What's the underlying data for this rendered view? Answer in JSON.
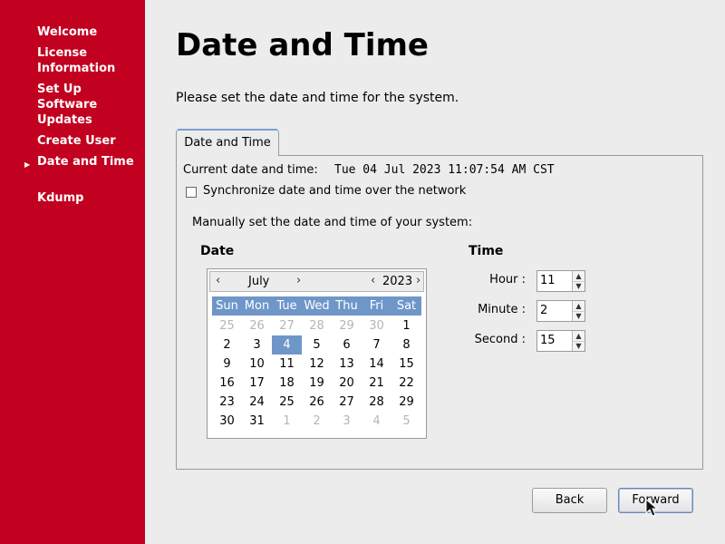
{
  "sidebar": {
    "items": [
      {
        "label": "Welcome"
      },
      {
        "label": "License Information"
      },
      {
        "label": "Set Up Software Updates"
      },
      {
        "label": "Create User"
      },
      {
        "label": "Date and Time"
      },
      {
        "label": "Kdump"
      }
    ],
    "active_icon": "arrow-right-icon"
  },
  "page": {
    "title": "Date and Time",
    "instruction": "Please set the date and time for the system."
  },
  "tab": {
    "label": "Date and Time"
  },
  "current": {
    "label": "Current date and time:",
    "value": "Tue 04 Jul 2023 11:07:54 AM CST"
  },
  "sync": {
    "label": "Synchronize date and time over the network",
    "checked": false
  },
  "manual": {
    "label": "Manually set the date and time of your system:"
  },
  "date": {
    "heading": "Date",
    "month": "July",
    "year": "2023",
    "weekdays": [
      "Sun",
      "Mon",
      "Tue",
      "Wed",
      "Thu",
      "Fri",
      "Sat"
    ],
    "weeks": [
      [
        "25",
        "26",
        "27",
        "28",
        "29",
        "30",
        "1"
      ],
      [
        "2",
        "3",
        "4",
        "5",
        "6",
        "7",
        "8"
      ],
      [
        "9",
        "10",
        "11",
        "12",
        "13",
        "14",
        "15"
      ],
      [
        "16",
        "17",
        "18",
        "19",
        "20",
        "21",
        "22"
      ],
      [
        "23",
        "24",
        "25",
        "26",
        "27",
        "28",
        "29"
      ],
      [
        "30",
        "31",
        "1",
        "2",
        "3",
        "4",
        "5"
      ]
    ],
    "selected_day": "4"
  },
  "time": {
    "heading": "Time",
    "hour_label": "Hour :",
    "hour_value": "11",
    "minute_label": "Minute :",
    "minute_value": "2",
    "second_label": "Second :",
    "second_value": "15"
  },
  "buttons": {
    "back_label": "Back",
    "forward_label": "Forward"
  },
  "colors": {
    "sidebar": "#c2001f",
    "selected": "#6f96c9"
  }
}
